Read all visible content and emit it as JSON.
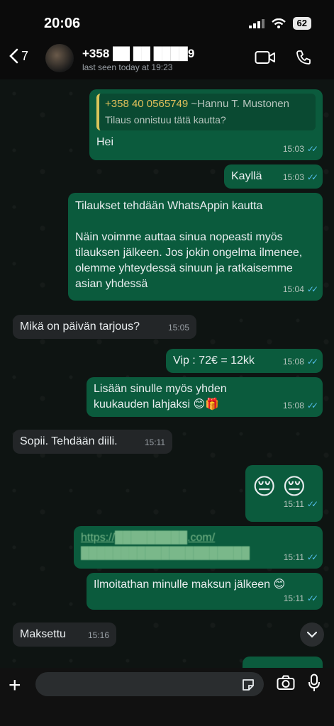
{
  "status_bar": {
    "time": "20:06",
    "battery": "62"
  },
  "header": {
    "back_count": "7",
    "contact_name": "+358 ██ ██ ████9",
    "last_seen": "last seen today at 19:23"
  },
  "messages": [
    {
      "id": "m1",
      "dir": "out",
      "quote_name": "+358 40 0565749",
      "quote_author": "~Hannu T. Mustonen",
      "quote_text": "Tilaus onnistuu tätä kautta?",
      "text": "Hei",
      "time": "15:03"
    },
    {
      "id": "m2",
      "dir": "out",
      "text": "Kayllä",
      "time": "15:03"
    },
    {
      "id": "m3",
      "dir": "out",
      "text_line1": "Tilaukset tehdään WhatsAppin kautta",
      "text_line2": "Näin voimme auttaa sinua nopeasti myös tilauksen jälkeen. Jos jokin ongelma ilmenee, olemme yhteydessä sinuun ja ratkaisemme asian yhdessä",
      "time": "15:04"
    },
    {
      "id": "m4",
      "dir": "in",
      "text": "Mikä on päivän tarjous?",
      "time": "15:05"
    },
    {
      "id": "m5",
      "dir": "out",
      "text": "Vip : 72€ = 12kk",
      "time": "15:08"
    },
    {
      "id": "m6",
      "dir": "out",
      "text": "Lisään sinulle myös yhden kuukauden lahjaksi 😊🎁",
      "time": "15:08"
    },
    {
      "id": "m7",
      "dir": "in",
      "text": "Sopii. Tehdään diili.",
      "time": "15:11"
    },
    {
      "id": "m8",
      "dir": "out",
      "text": "😔 😔",
      "time": "15:11"
    },
    {
      "id": "m9",
      "dir": "out",
      "link_line1": "https://█████████.com/",
      "link_line2": "█████████████████████",
      "time": "15:11"
    },
    {
      "id": "m10",
      "dir": "out",
      "text": "Ilmoitathan minulle maksun jälkeen 😊",
      "time": "15:11"
    },
    {
      "id": "m11",
      "dir": "in",
      "text": "Maksettu",
      "time": "15:16"
    }
  ],
  "composer": {
    "placeholder": ""
  },
  "colors": {
    "outgoing": "#0b5b3d",
    "incoming": "#232628",
    "read_ticks": "#53bdeb",
    "quote_bar": "#d9c45a"
  }
}
